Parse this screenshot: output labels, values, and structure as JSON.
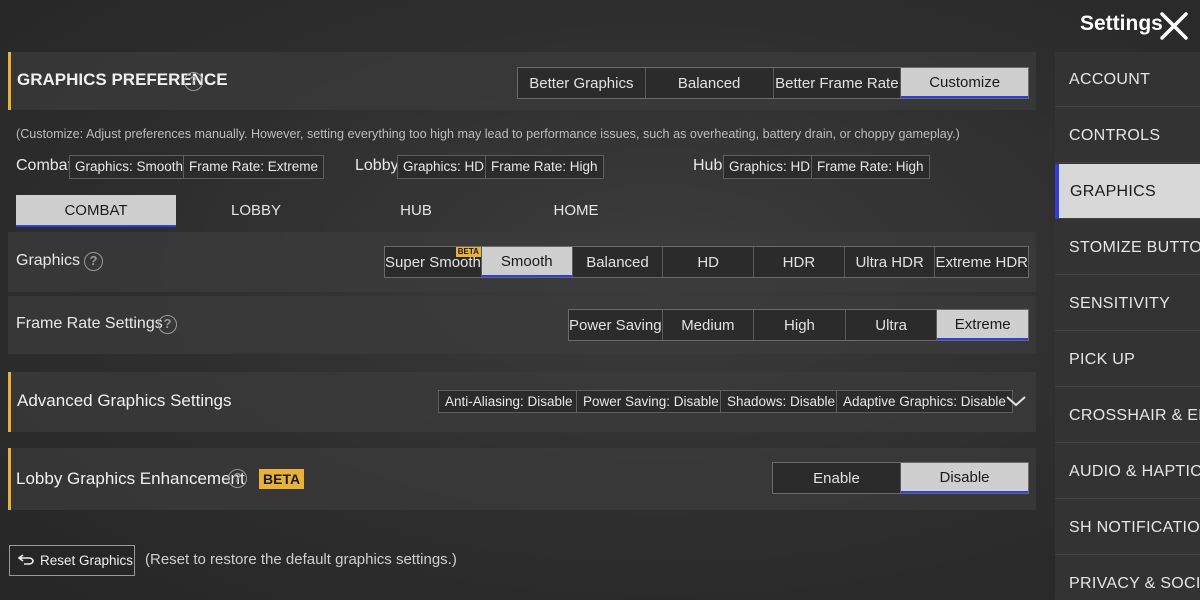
{
  "header": {
    "title": "Settings",
    "close_icon": "close-icon"
  },
  "preference": {
    "label": "GRAPHICS PREFERENCE",
    "options": [
      "Better Graphics",
      "Balanced",
      "Better Frame Rate",
      "Customize"
    ],
    "selected": "Customize",
    "note": "(Customize: Adjust preferences manually. However, setting everything too high may lead to performance issues, such as overheating, battery drain, or choppy gameplay.)"
  },
  "summary": {
    "combat": {
      "label": "Combat",
      "graphics": "Graphics: Smooth",
      "frame": "Frame Rate: Extreme"
    },
    "lobby": {
      "label": "Lobby",
      "graphics": "Graphics: HD",
      "frame": "Frame Rate: High"
    },
    "hub": {
      "label": "Hub",
      "graphics": "Graphics: HD",
      "frame": "Frame Rate: High"
    }
  },
  "tabs": [
    "COMBAT",
    "LOBBY",
    "HUB",
    "HOME"
  ],
  "active_tab": "COMBAT",
  "graphics": {
    "label": "Graphics",
    "options": [
      "Super Smooth",
      "Smooth",
      "Balanced",
      "HD",
      "HDR",
      "Ultra HDR",
      "Extreme HDR"
    ],
    "beta_badge": "BETA",
    "selected": "Smooth"
  },
  "frame_rate": {
    "label": "Frame Rate Settings",
    "options": [
      "Power Saving",
      "Medium",
      "High",
      "Ultra",
      "Extreme"
    ],
    "selected": "Extreme"
  },
  "advanced": {
    "label": "Advanced Graphics Settings",
    "tags": [
      "Anti-Aliasing: Disable",
      "Power Saving: Disable",
      "Shadows: Disable",
      "Adaptive Graphics: Disable"
    ]
  },
  "lobby_enhancement": {
    "label": "Lobby Graphics Enhancement",
    "badge": "BETA",
    "options": [
      "Enable",
      "Disable"
    ],
    "selected": "Disable"
  },
  "reset": {
    "button_label": "Reset Graphics",
    "note": "(Reset to restore the default graphics settings.)"
  },
  "sidebar": {
    "items": [
      "ACCOUNT",
      "CONTROLS",
      "GRAPHICS",
      "STOMIZE BUTTONS",
      "SENSITIVITY",
      "PICK UP",
      "CROSSHAIR & EFFI",
      "AUDIO & HAPTICS",
      "SH NOTIFICATIONS",
      "PRIVACY & SOCIAL"
    ],
    "active": "GRAPHICS"
  },
  "colors": {
    "accent_yellow": "#e8b23a",
    "selection_blue": "#2f3fd8",
    "selected_bg": "#cfcfcf"
  }
}
